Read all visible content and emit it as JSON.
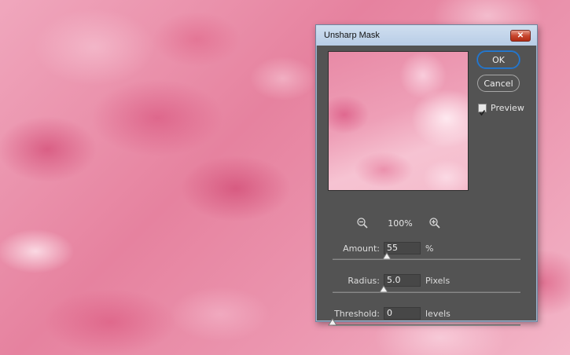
{
  "dialog": {
    "title": "Unsharp Mask",
    "close_glyph": "✕",
    "buttons": {
      "ok": "OK",
      "cancel": "Cancel"
    },
    "preview": {
      "label": "Preview",
      "checked": true,
      "zoom_level": "100%"
    },
    "params": {
      "amount": {
        "label": "Amount:",
        "value": "55",
        "unit": "%",
        "slider_fraction": 0.29
      },
      "radius": {
        "label": "Radius:",
        "value": "5.0",
        "unit": "Pixels",
        "slider_fraction": 0.27
      },
      "threshold": {
        "label": "Threshold:",
        "value": "0",
        "unit": "levels",
        "slider_fraction": 0.0
      }
    },
    "icons": {
      "zoom_out": "zoom-out-icon",
      "zoom_in": "zoom-in-icon",
      "close": "close-icon",
      "checkbox": "checkmark-icon"
    },
    "colors": {
      "dialog_bg": "#535353",
      "ok_focus_ring": "#1f7fe0",
      "close_button": "#c7472f"
    }
  }
}
